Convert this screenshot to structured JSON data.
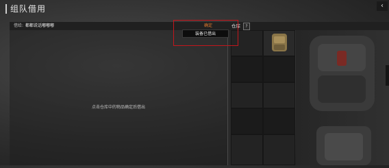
{
  "header": {
    "title": "组队借用",
    "version": "",
    "back_icon": "chevron-left-icon"
  },
  "toolbar": {
    "borrower_label": "借给:",
    "borrower_name": "都都说话嘟嘟嘟",
    "confirm_label": "确定",
    "warehouse_label": "仓库",
    "help_label": "?"
  },
  "tooltip": {
    "text": "装备已借出"
  },
  "left_panel": {
    "hint": "点击仓库中的物品确定后借出"
  },
  "colors": {
    "accent_orange": "#e07a2e",
    "highlight_red": "#c4161c"
  }
}
